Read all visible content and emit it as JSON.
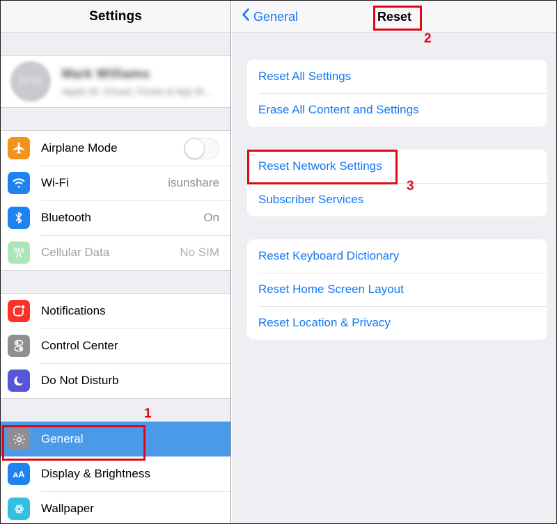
{
  "sidebar": {
    "header_title": "Settings",
    "profile": {
      "initials": "MW",
      "name": "Mark Williams",
      "subtitle": "Apple ID, iCloud, iTunes & App St...",
      "blurred": true
    },
    "groups": [
      {
        "id": "connectivity",
        "items": [
          {
            "label": "Airplane Mode",
            "icon": "airplane-icon",
            "icon_color": "#f5921e",
            "control": "toggle",
            "toggle_on": false,
            "value": "",
            "dimmed": false
          },
          {
            "label": "Wi-Fi",
            "icon": "wifi-icon",
            "icon_color": "#1e82f0",
            "control": "value",
            "value": "isunshare",
            "dimmed": false
          },
          {
            "label": "Bluetooth",
            "icon": "bluetooth-icon",
            "icon_color": "#1e82f0",
            "control": "value",
            "value": "On",
            "dimmed": false
          },
          {
            "label": "Cellular Data",
            "icon": "cellular-icon",
            "icon_color": "#8ddaa0",
            "control": "value",
            "value": "No SIM",
            "dimmed": true
          }
        ]
      },
      {
        "id": "alerts",
        "items": [
          {
            "label": "Notifications",
            "icon": "notifications-icon",
            "icon_color": "#fc3129",
            "control": "none",
            "value": "",
            "dimmed": false
          },
          {
            "label": "Control Center",
            "icon": "control-center-icon",
            "icon_color": "#8e8e93",
            "control": "none",
            "value": "",
            "dimmed": false
          },
          {
            "label": "Do Not Disturb",
            "icon": "moon-icon",
            "icon_color": "#5756d6",
            "control": "none",
            "value": "",
            "dimmed": false
          }
        ]
      },
      {
        "id": "system",
        "items": [
          {
            "label": "General",
            "icon": "gear-icon",
            "icon_color": "#8e8e93",
            "control": "none",
            "value": "",
            "dimmed": false,
            "selected": true
          },
          {
            "label": "Display & Brightness",
            "icon": "display-brightness-icon",
            "icon_color": "#1e82f0",
            "control": "none",
            "value": "",
            "dimmed": false
          },
          {
            "label": "Wallpaper",
            "icon": "wallpaper-icon",
            "icon_color": "#34bfe0",
            "control": "none",
            "value": "",
            "dimmed": false
          }
        ]
      }
    ]
  },
  "detail": {
    "back_label": "General",
    "back_chevron": "‹",
    "title": "Reset",
    "groups": [
      {
        "id": "reset-erase",
        "items": [
          {
            "label": "Reset All Settings"
          },
          {
            "label": "Erase All Content and Settings"
          }
        ]
      },
      {
        "id": "network",
        "items": [
          {
            "label": "Reset Network Settings"
          },
          {
            "label": "Subscriber Services"
          }
        ]
      },
      {
        "id": "misc",
        "items": [
          {
            "label": "Reset Keyboard Dictionary"
          },
          {
            "label": "Reset Home Screen Layout"
          },
          {
            "label": "Reset Location & Privacy"
          }
        ]
      }
    ]
  },
  "annotations": {
    "color": "#e30613",
    "markers": [
      {
        "number": "1",
        "target": "sidebar-item-general"
      },
      {
        "number": "2",
        "target": "detail-title-reset"
      },
      {
        "number": "3",
        "target": "detail-item-reset-network-settings"
      }
    ]
  }
}
